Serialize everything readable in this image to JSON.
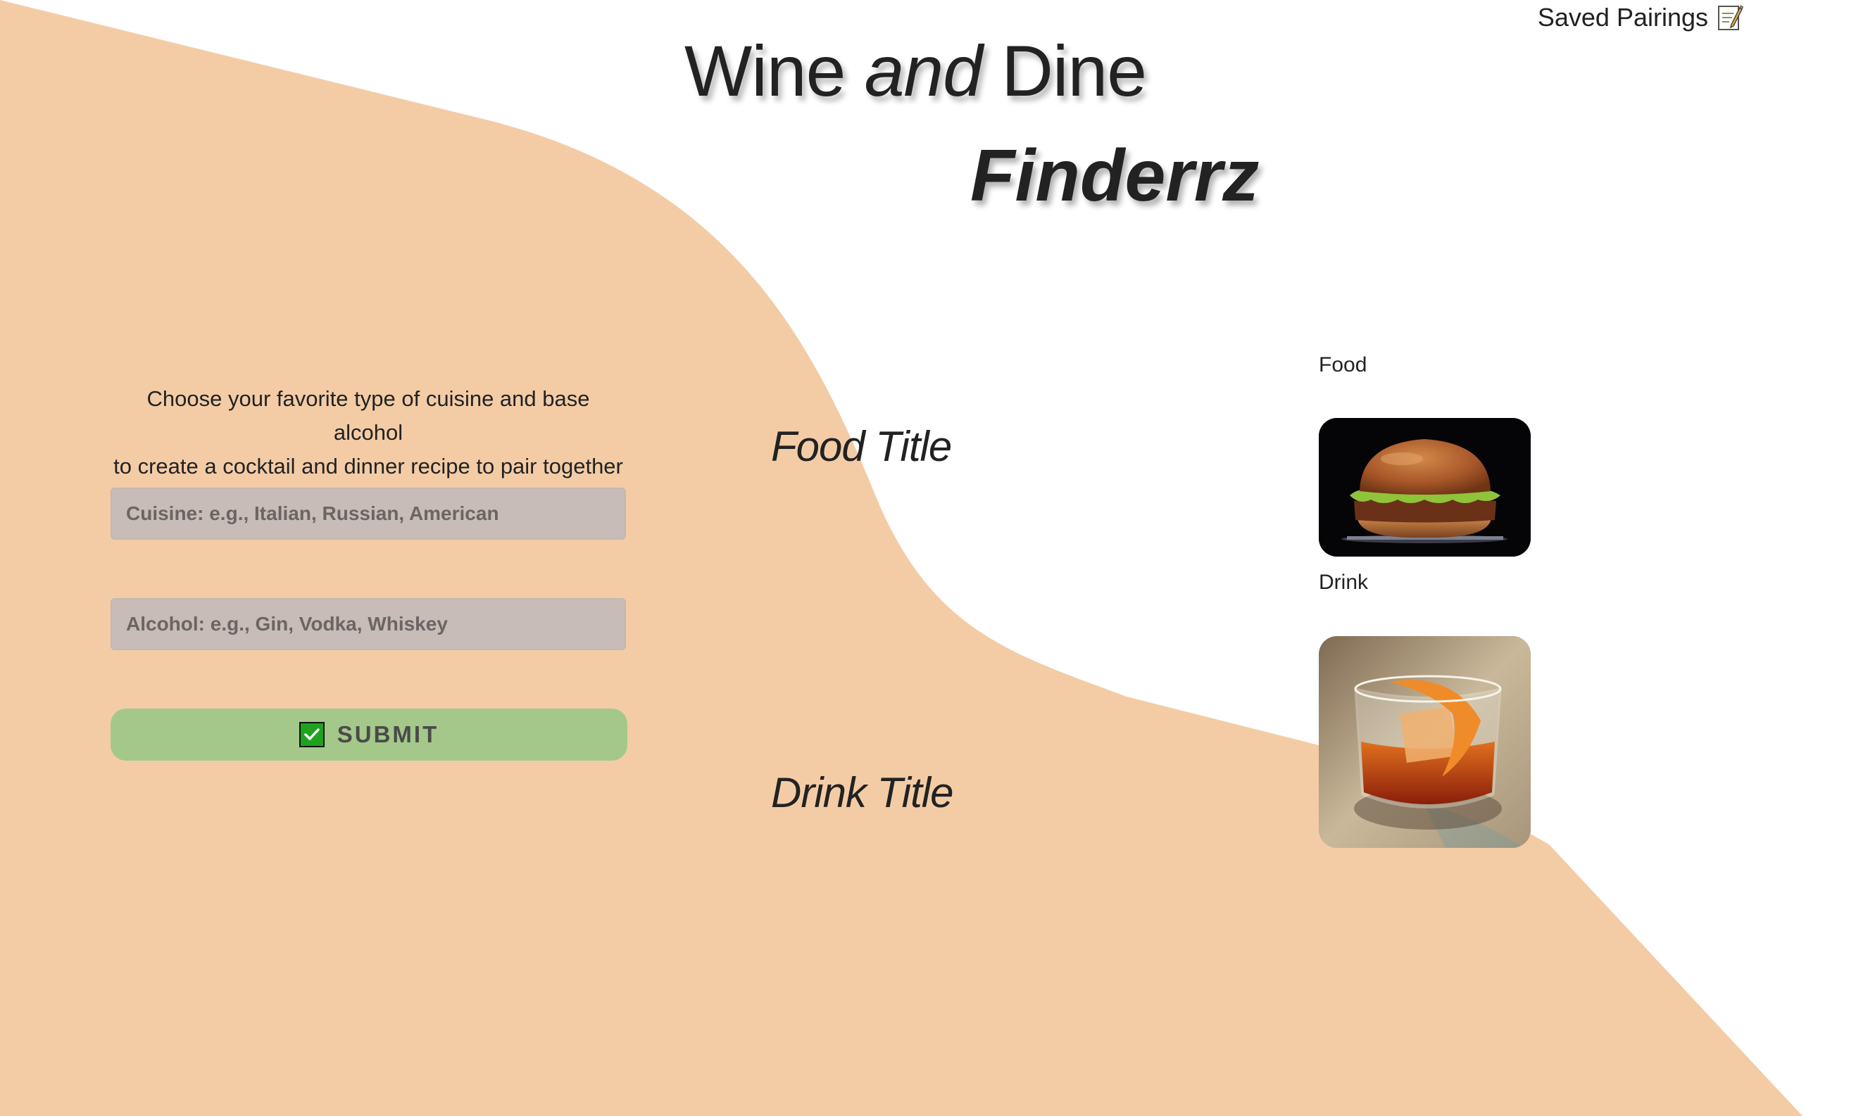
{
  "header": {
    "saved_link_label": "Saved Pairings",
    "saved_icon": "memo-icon"
  },
  "title": {
    "word1": "Wine",
    "word2": "and",
    "word3": "Dine",
    "subtitle": "Finderrz"
  },
  "form": {
    "intro_line1": "Choose your favorite type of cuisine and base alcohol",
    "intro_line2": "to create a cocktail and dinner recipe to pair together",
    "cuisine_placeholder": "Cuisine: e.g., Italian, Russian, American",
    "alcohol_placeholder": "Alcohol: e.g., Gin, Vodka, Whiskey",
    "submit_label": "SUBMIT",
    "submit_icon": "check-box-icon"
  },
  "results": {
    "food_title": "Food Title",
    "drink_title": "Drink Title",
    "food_label": "Food",
    "drink_label": "Drink",
    "food_image": "burger-image",
    "drink_image": "cocktail-image"
  },
  "colors": {
    "background_blob": "#f3cca6",
    "input_bg": "#c8bcb8",
    "submit_bg": "#a4c88a",
    "text": "#222222"
  }
}
